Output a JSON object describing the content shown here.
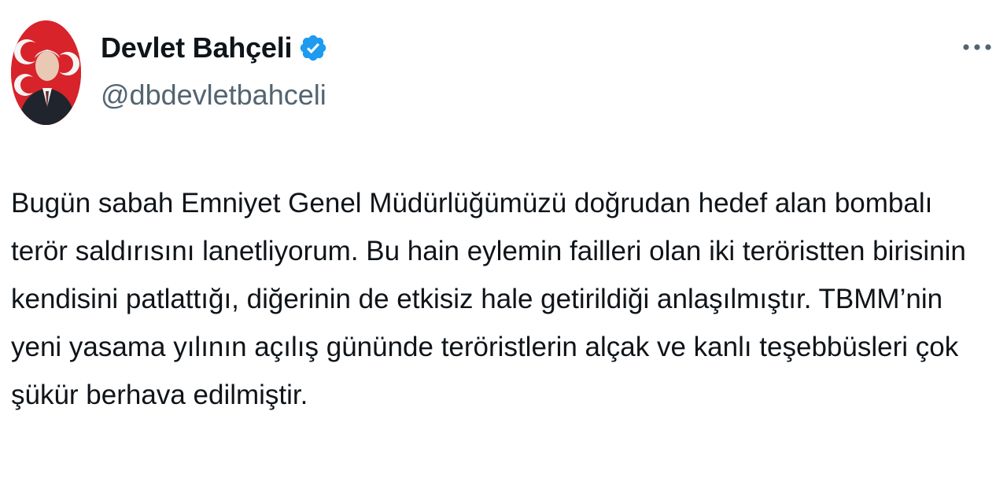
{
  "author": {
    "display_name": "Devlet Bahçeli",
    "handle": "@dbdevletbahceli",
    "verified": true,
    "avatar_icon": "profile-photo-icon"
  },
  "menu": {
    "more_icon": "more-options-icon"
  },
  "tweet": {
    "text": "Bugün sabah Emniyet Genel Müdürlüğümüzü doğrudan hedef alan bombalı terör saldırısını lanetliyorum. Bu hain eylemin failleri olan iki teröristten birisinin kendisini patlattığı, diğerinin de etkisiz hale getirildiği anlaşılmıştır. TBMM’nin yeni yasama yılının açılış gününde teröristlerin alçak ve kanlı teşebbüsleri çok şükür berhava edilmiştir."
  },
  "colors": {
    "verified_badge": "#1d9bf0",
    "secondary_text": "#536471",
    "primary_text": "#0f1419",
    "avatar_background": "#d8232a"
  }
}
